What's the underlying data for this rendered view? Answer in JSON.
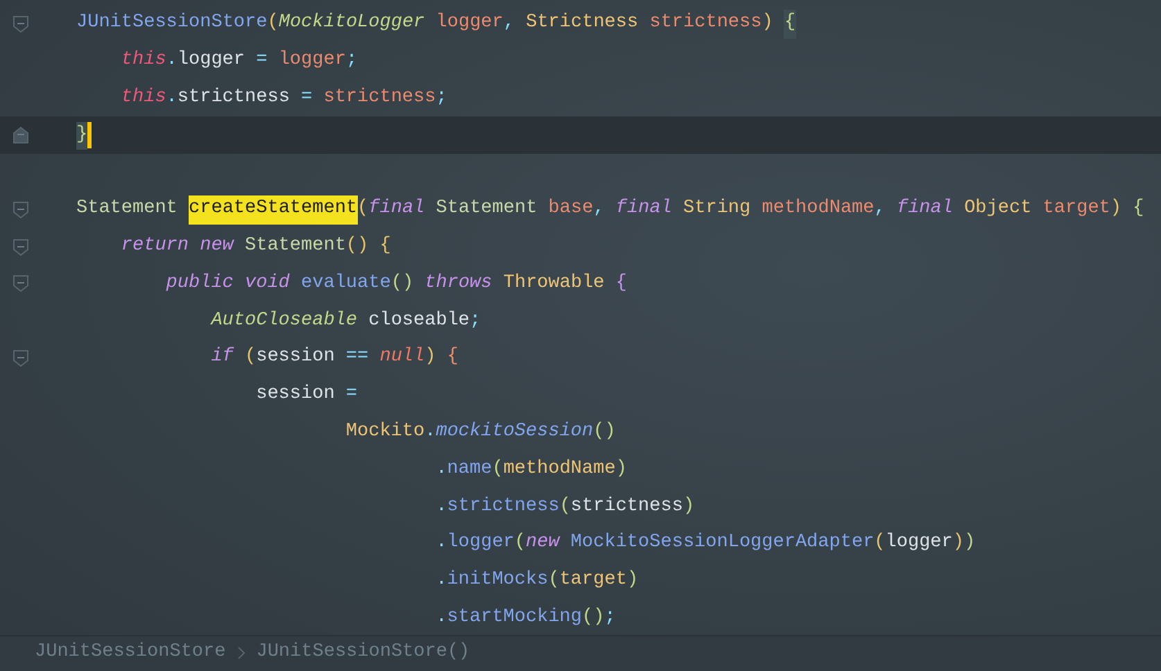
{
  "editor": {
    "blocks": [
      {
        "lines": [
          {
            "fold_start": true,
            "tokens": [
              {
                "text": "JUnitSessionStore",
                "kind": "method"
              },
              {
                "text": "(",
                "kind": "bracket1"
              },
              {
                "text": "MockitoLogger",
                "kind": "itype"
              },
              {
                "text": " logger",
                "kind": "param"
              },
              {
                "text": ",",
                "kind": "op"
              },
              {
                "text": " Strictness",
                "kind": "type"
              },
              {
                "text": " strictness",
                "kind": "param"
              },
              {
                "text": ") ",
                "kind": "bracket1"
              },
              {
                "text": "{",
                "kind": "match"
              }
            ],
            "children": [
              {
                "tokens": [
                  {
                    "text": "this",
                    "kind": "this"
                  },
                  {
                    "text": ".",
                    "kind": "op"
                  },
                  {
                    "text": "logger",
                    "kind": "plain"
                  },
                  {
                    "text": " =",
                    "kind": "op"
                  },
                  {
                    "text": " logger",
                    "kind": "param"
                  },
                  {
                    "text": ";",
                    "kind": "op"
                  }
                ]
              },
              {
                "tokens": [
                  {
                    "text": "this",
                    "kind": "this"
                  },
                  {
                    "text": ".",
                    "kind": "op"
                  },
                  {
                    "text": "strictness",
                    "kind": "plain"
                  },
                  {
                    "text": " =",
                    "kind": "op"
                  },
                  {
                    "text": " strictness",
                    "kind": "param"
                  },
                  {
                    "text": ";",
                    "kind": "op"
                  }
                ]
              }
            ]
          },
          {
            "fold_end": true,
            "current": true,
            "tokens": [
              {
                "text": "}",
                "kind": "match"
              }
            ]
          }
        ]
      },
      {
        "lines": [
          {
            "fold_start": true,
            "tokens": [
              {
                "text": "Statement ",
                "kind": "class"
              },
              {
                "text": "createStatement",
                "kind": "highlight"
              },
              {
                "text": "(",
                "kind": "bracket1"
              },
              {
                "text": "final",
                "kind": "keyword"
              },
              {
                "text": " Statement",
                "kind": "class"
              },
              {
                "text": " base",
                "kind": "param"
              },
              {
                "text": ",",
                "kind": "op"
              },
              {
                "text": " final",
                "kind": "keyword"
              },
              {
                "text": " String",
                "kind": "type"
              },
              {
                "text": " methodName",
                "kind": "param"
              },
              {
                "text": ",",
                "kind": "op"
              },
              {
                "text": " final",
                "kind": "keyword"
              },
              {
                "text": " Object",
                "kind": "type"
              },
              {
                "text": " target",
                "kind": "param"
              },
              {
                "text": ")",
                "kind": "bracket1"
              },
              {
                "text": " {",
                "kind": "bracket2"
              }
            ],
            "children": [
              {
                "fold_start": true,
                "tokens": [
                  {
                    "text": "return",
                    "kind": "keyword"
                  },
                  {
                    "text": " new",
                    "kind": "keyword"
                  },
                  {
                    "text": " Statement",
                    "kind": "class"
                  },
                  {
                    "text": "()",
                    "kind": "bracket1"
                  },
                  {
                    "text": " {",
                    "kind": "bracket1"
                  }
                ],
                "children": [
                  {
                    "fold_start": true,
                    "tokens": [
                      {
                        "text": "public",
                        "kind": "keyword"
                      },
                      {
                        "text": " void",
                        "kind": "keyword"
                      },
                      {
                        "text": " evaluate",
                        "kind": "method"
                      },
                      {
                        "text": "()",
                        "kind": "bracket2"
                      },
                      {
                        "text": " throws",
                        "kind": "keyword"
                      },
                      {
                        "text": " Throwable",
                        "kind": "type"
                      },
                      {
                        "text": " {",
                        "kind": "bracket3"
                      }
                    ],
                    "children": [
                      {
                        "tokens": [
                          {
                            "text": "AutoCloseable",
                            "kind": "itype"
                          },
                          {
                            "text": " closeable",
                            "kind": "plain"
                          },
                          {
                            "text": ";",
                            "kind": "op"
                          }
                        ]
                      },
                      {
                        "fold_start": true,
                        "tokens": [
                          {
                            "text": "if",
                            "kind": "keyword"
                          },
                          {
                            "text": " (",
                            "kind": "bracket1"
                          },
                          {
                            "text": "session",
                            "kind": "plain"
                          },
                          {
                            "text": " ==",
                            "kind": "op"
                          },
                          {
                            "text": " null",
                            "kind": "null"
                          },
                          {
                            "text": ")",
                            "kind": "bracket1"
                          },
                          {
                            "text": " {",
                            "kind": "bracket4"
                          }
                        ],
                        "children": [
                          {
                            "tokens": [
                              {
                                "text": "session",
                                "kind": "plain"
                              },
                              {
                                "text": " =",
                                "kind": "op"
                              }
                            ],
                            "children": [
                              {
                                "tokens": [
                                  {
                                    "text": "Mockito",
                                    "kind": "type"
                                  },
                                  {
                                    "text": ".",
                                    "kind": "op"
                                  },
                                  {
                                    "text": "mockitoSession",
                                    "kind": "static"
                                  },
                                  {
                                    "text": "()",
                                    "kind": "bracket2"
                                  }
                                ],
                                "children": [
                                  {
                                    "tokens": [
                                      {
                                        "text": ".",
                                        "kind": "op"
                                      },
                                      {
                                        "text": "name",
                                        "kind": "method"
                                      },
                                      {
                                        "text": "(",
                                        "kind": "bracket2"
                                      },
                                      {
                                        "text": "methodName",
                                        "kind": "type"
                                      },
                                      {
                                        "text": ")",
                                        "kind": "bracket2"
                                      }
                                    ]
                                  },
                                  {
                                    "tokens": [
                                      {
                                        "text": ".",
                                        "kind": "op"
                                      },
                                      {
                                        "text": "strictness",
                                        "kind": "method"
                                      },
                                      {
                                        "text": "(",
                                        "kind": "bracket2"
                                      },
                                      {
                                        "text": "strictness",
                                        "kind": "plain"
                                      },
                                      {
                                        "text": ")",
                                        "kind": "bracket2"
                                      }
                                    ]
                                  },
                                  {
                                    "tokens": [
                                      {
                                        "text": ".",
                                        "kind": "op"
                                      },
                                      {
                                        "text": "logger",
                                        "kind": "method"
                                      },
                                      {
                                        "text": "(",
                                        "kind": "bracket2"
                                      },
                                      {
                                        "text": "new",
                                        "kind": "keyword"
                                      },
                                      {
                                        "text": " MockitoSessionLoggerAdapter",
                                        "kind": "method"
                                      },
                                      {
                                        "text": "(",
                                        "kind": "bracket1"
                                      },
                                      {
                                        "text": "logger",
                                        "kind": "plain"
                                      },
                                      {
                                        "text": ")",
                                        "kind": "bracket1"
                                      },
                                      {
                                        "text": ")",
                                        "kind": "bracket2"
                                      }
                                    ]
                                  },
                                  {
                                    "tokens": [
                                      {
                                        "text": ".",
                                        "kind": "op"
                                      },
                                      {
                                        "text": "initMocks",
                                        "kind": "method"
                                      },
                                      {
                                        "text": "(",
                                        "kind": "bracket2"
                                      },
                                      {
                                        "text": "target",
                                        "kind": "type"
                                      },
                                      {
                                        "text": ")",
                                        "kind": "bracket2"
                                      }
                                    ]
                                  },
                                  {
                                    "tokens": [
                                      {
                                        "text": ".",
                                        "kind": "op"
                                      },
                                      {
                                        "text": "startMocking",
                                        "kind": "method"
                                      },
                                      {
                                        "text": "()",
                                        "kind": "bracket2"
                                      },
                                      {
                                        "text": ";",
                                        "kind": "op"
                                      }
                                    ]
                                  }
                                ]
                              }
                            ]
                          }
                        ]
                      }
                    ]
                  }
                ]
              }
            ]
          }
        ]
      }
    ]
  },
  "breadcrumbs": [
    {
      "label": "JUnitSessionStore"
    },
    {
      "label": "JUnitSessionStore()"
    }
  ]
}
